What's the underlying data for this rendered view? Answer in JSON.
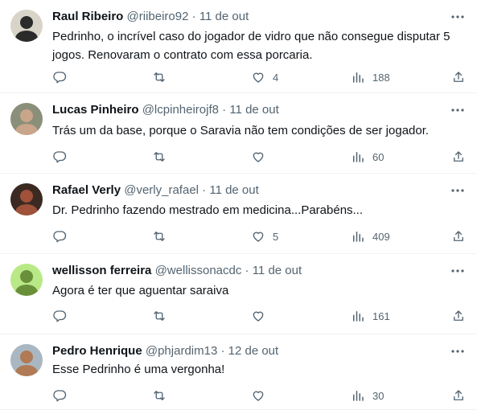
{
  "tweets": [
    {
      "name": "Raul Ribeiro",
      "handle": "@riibeiro92",
      "sep": "·",
      "date": "11 de out",
      "text": "Pedrinho, o incrível caso do jogador de vidro que não consegue disputar 5 jogos. Renovaram o contrato com essa porcaria.",
      "likes": "4",
      "views": "188",
      "avatar_icon": "avatar-icon",
      "avatar_colors": [
        "#d9d4c8",
        "#2b2b2b"
      ]
    },
    {
      "name": "Lucas Pinheiro",
      "handle": "@lcpinheirojf8",
      "sep": "·",
      "date": "11 de out",
      "text": "Trás um da base, porque o Saravia não tem condições de ser jogador.",
      "likes": "",
      "views": "60",
      "avatar_icon": "avatar-icon",
      "avatar_colors": [
        "#8a8f7a",
        "#c9a58a"
      ]
    },
    {
      "name": "Rafael Verly",
      "handle": "@verly_rafael",
      "sep": "·",
      "date": "11 de out",
      "text": "Dr. Pedrinho fazendo mestrado em medicina...Parabéns...",
      "likes": "5",
      "views": "409",
      "avatar_icon": "avatar-icon",
      "avatar_colors": [
        "#3a2a22",
        "#a0513a"
      ]
    },
    {
      "name": "wellisson ferreira",
      "handle": "@wellissonacdc",
      "sep": "·",
      "date": "11 de out",
      "text": "Agora é ter que aguentar saraiva",
      "likes": "",
      "views": "161",
      "avatar_icon": "avatar-icon",
      "avatar_colors": [
        "#b8e986",
        "#6a8f3a"
      ]
    },
    {
      "name": "Pedro Henrique",
      "handle": "@phjardim13",
      "sep": "·",
      "date": "12 de out",
      "text": "Esse Pedrinho é uma vergonha!",
      "likes": "",
      "views": "30",
      "avatar_icon": "avatar-icon",
      "avatar_colors": [
        "#a9b7c2",
        "#b07a55"
      ]
    }
  ],
  "icons": {
    "more": "more-icon",
    "reply": "reply-icon",
    "retweet": "retweet-icon",
    "like": "like-icon",
    "views": "views-icon",
    "share": "share-icon"
  },
  "colors": {
    "text": "#0f1419",
    "secondary": "#536471",
    "divider": "#eff3f4"
  }
}
